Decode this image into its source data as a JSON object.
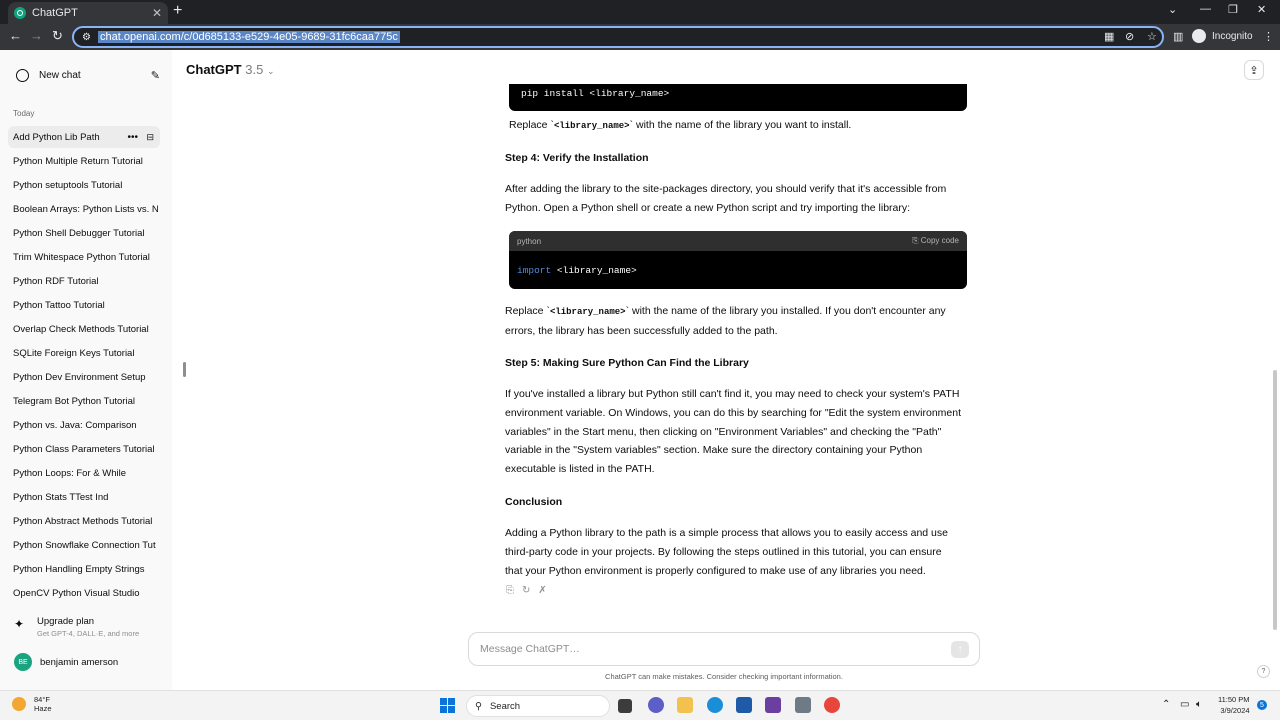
{
  "browser": {
    "tab_title": "ChatGPT",
    "url": "chat.openai.com/c/0d685133-e529-4e05-9689-31fc6caa775c",
    "incognito_label": "Incognito"
  },
  "sidebar": {
    "new_chat_label": "New chat",
    "section_today": "Today",
    "items": [
      {
        "label": "Add Python Lib Path",
        "active": true
      },
      {
        "label": "Python Multiple Return Tutorial"
      },
      {
        "label": "Python setuptools Tutorial"
      },
      {
        "label": "Boolean Arrays: Python Lists vs. N"
      },
      {
        "label": "Python Shell Debugger Tutorial"
      },
      {
        "label": "Trim Whitespace Python Tutorial"
      },
      {
        "label": "Python RDF Tutorial"
      },
      {
        "label": "Python Tattoo Tutorial"
      },
      {
        "label": "Overlap Check Methods Tutorial"
      },
      {
        "label": "SQLite Foreign Keys Tutorial"
      },
      {
        "label": "Python Dev Environment Setup"
      },
      {
        "label": "Telegram Bot Python Tutorial"
      },
      {
        "label": "Python vs. Java: Comparison"
      },
      {
        "label": "Python Class Parameters Tutorial"
      },
      {
        "label": "Python Loops: For & While"
      },
      {
        "label": "Python Stats TTest Ind"
      },
      {
        "label": "Python Abstract Methods Tutorial"
      },
      {
        "label": "Python Snowflake Connection Tut"
      },
      {
        "label": "Python Handling Empty Strings"
      },
      {
        "label": "OpenCV Python Visual Studio"
      }
    ],
    "upgrade_title": "Upgrade plan",
    "upgrade_subtitle": "Get GPT-4, DALL·E, and more",
    "user_initials": "BE",
    "user_name": "benjamin amerson"
  },
  "header": {
    "model_name": "ChatGPT",
    "model_version": "3.5"
  },
  "message": {
    "code1": "pip install <library_name>",
    "p1_pre": "Replace `",
    "p1_code": "<library_name>",
    "p1_post": "` with the name of the library you want to install.",
    "step4_heading": "Step 4: Verify the Installation",
    "p2_line1": "After adding the library to the site-packages directory, you should verify that it's accessible from",
    "p2_line2": "Python. Open a Python shell or create a new Python script and try importing the library:",
    "code2_lang": "python",
    "code2_copy": "Copy code",
    "code2_keyword": "import",
    "code2_rest": " <library_name>",
    "p3_pre": "Replace `",
    "p3_code": "<library_name>",
    "p3_post": "` with the name of the library you installed. If you don't encounter any",
    "p3_line2": "errors, the library has been successfully added to the path.",
    "step5_heading": "Step 5: Making Sure Python Can Find the Library",
    "p4_line1": "If you've installed a library but Python still can't find it, you may need to check your system's PATH",
    "p4_line2": "environment variable. On Windows, you can do this by searching for \"Edit the system environment",
    "p4_line3": "variables\" in the Start menu, then clicking on \"Environment Variables\" and checking the \"Path\"",
    "p4_line4": "variable in the \"System variables\" section. Make sure the directory containing your Python",
    "p4_line5": "executable is listed in the PATH.",
    "conclusion_heading": "Conclusion",
    "p5_line1": "Adding a Python library to the path is a simple process that allows you to easily access and use",
    "p5_line2": "third-party code in your projects. By following the steps outlined in this tutorial, you can ensure",
    "p5_line3": "that your Python environment is properly configured to make use of any libraries you need."
  },
  "composer": {
    "placeholder": "Message ChatGPT…",
    "disclaimer": "ChatGPT can make mistakes. Consider checking important information."
  },
  "taskbar": {
    "temperature": "84°F",
    "condition": "Haze",
    "search_label": "Search",
    "time": "11:50 PM",
    "date": "3/9/2024",
    "notifications": "5"
  }
}
